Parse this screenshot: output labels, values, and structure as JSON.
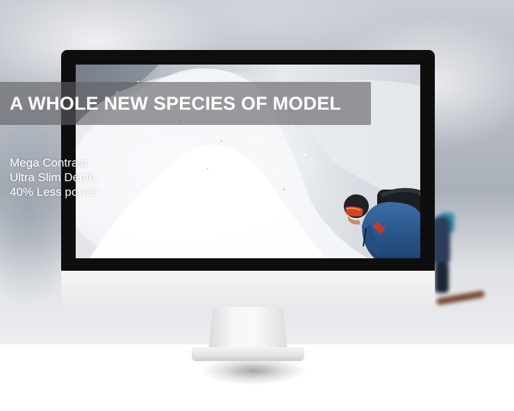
{
  "headline": "A WHOLE NEW SPECIES OF MODEL",
  "features": [
    "Mega Contrast",
    "Ultra Slim Depth",
    "40% Less power"
  ],
  "colors": {
    "bezel": "#0e0e0f",
    "chin": "#f0f1f2",
    "band": "#5f5f64",
    "text": "#ffffff",
    "jacket": "#2a5b92",
    "helmet": "#1f2328",
    "goggles": "#d6431d"
  }
}
